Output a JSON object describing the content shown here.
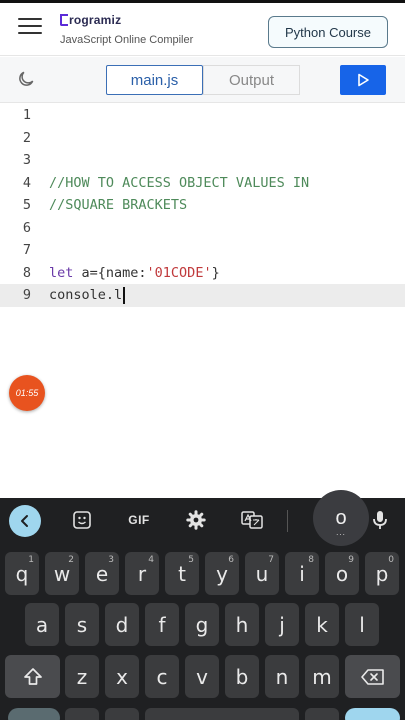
{
  "header": {
    "logo_text": "rogramiz",
    "subtitle": "JavaScript Online Compiler",
    "course_button": "Python Course"
  },
  "toolbar": {
    "tabs": [
      {
        "label": "main.js",
        "active": true
      },
      {
        "label": "Output",
        "active": false
      }
    ],
    "run_icon": "play-icon",
    "theme_icon": "moon-icon"
  },
  "editor": {
    "line_numbers": [
      "1",
      "2",
      "3",
      "4",
      "5",
      "6",
      "7",
      "8",
      "9"
    ],
    "active_line": "9",
    "lines": {
      "l4_comment": "//HOW TO ACCESS OBJECT VALUES IN",
      "l5_comment": "//SQUARE BRACKETS",
      "l8_keyword": "let",
      "l8_var": " a={name:",
      "l8_string": "'01CODE'",
      "l8_close": "}",
      "l9_text": "console.l"
    }
  },
  "overlay": {
    "timer": "01:55"
  },
  "keyboard": {
    "toolbar": {
      "gif_label": "GIF",
      "suggestion": "o",
      "suggestion_dots": "..."
    },
    "row1": [
      {
        "key": "q",
        "hint": "1"
      },
      {
        "key": "w",
        "hint": "2"
      },
      {
        "key": "e",
        "hint": "3"
      },
      {
        "key": "r",
        "hint": "4"
      },
      {
        "key": "t",
        "hint": "5"
      },
      {
        "key": "y",
        "hint": "6"
      },
      {
        "key": "u",
        "hint": "7"
      },
      {
        "key": "i",
        "hint": "8"
      },
      {
        "key": "o",
        "hint": "9"
      },
      {
        "key": "p",
        "hint": "0"
      }
    ],
    "row2": [
      "a",
      "s",
      "d",
      "f",
      "g",
      "h",
      "j",
      "k",
      "l"
    ],
    "row3": [
      "z",
      "x",
      "c",
      "v",
      "b",
      "n",
      "m"
    ],
    "colors": {
      "background": "#1f2022",
      "key": "#3b3c3e",
      "accent": "#9fd6ee"
    }
  },
  "colors": {
    "run_button": "#1764e8",
    "active_tab_border": "#3b6fb6",
    "timer_badge": "#e8531f",
    "comment": "#4e8a5a",
    "keyword": "#6a3aa8",
    "string": "#c0393b"
  }
}
